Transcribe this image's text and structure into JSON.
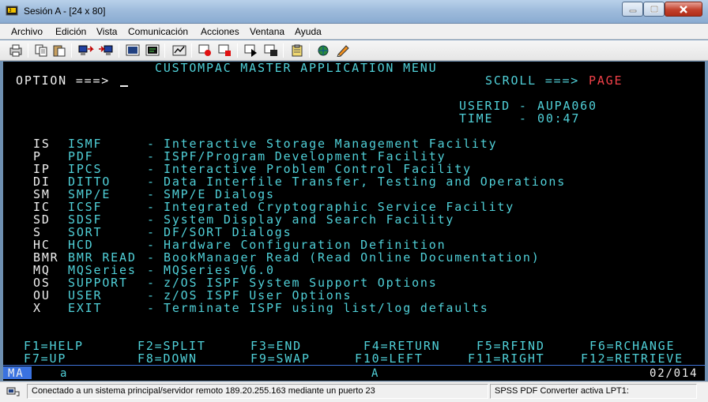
{
  "window": {
    "title": "Sesión A - [24 x 80]"
  },
  "menubar": {
    "items": [
      "Archivo",
      "Edición",
      "Vista",
      "Comunicación",
      "Acciones",
      "Ventana",
      "Ayuda"
    ]
  },
  "toolbar": {
    "icons": [
      "print-icon",
      "copy-icon",
      "paste-icon",
      "send-file-icon",
      "receive-file-icon",
      "screen-display-icon",
      "screen-color-icon",
      "macro-icon",
      "record-macro-icon",
      "stop-macro-icon",
      "play-macro-icon",
      "run-icon",
      "clipboard-icon",
      "network-icon",
      "keyboard-map-icon"
    ]
  },
  "terminal": {
    "header_title": "CUSTOMPAC MASTER APPLICATION MENU",
    "option_label": "OPTION ===>",
    "scroll_label": "SCROLL ===>",
    "scroll_value": "PAGE",
    "userid_label": "USERID -",
    "userid_value": "AUPA060",
    "time_label": "TIME   -",
    "time_value": "00:47",
    "menu_options": [
      {
        "code": "IS",
        "name": "ISMF",
        "dash": "-",
        "description": "Interactive Storage Management Facility"
      },
      {
        "code": "P",
        "name": "PDF",
        "dash": "-",
        "description": "ISPF/Program Development Facility"
      },
      {
        "code": "IP",
        "name": "IPCS",
        "dash": "-",
        "description": "Interactive Problem Control Facility"
      },
      {
        "code": "DI",
        "name": "DITTO",
        "dash": "-",
        "description": "Data Interfile Transfer, Testing and Operations"
      },
      {
        "code": "SM",
        "name": "SMP/E",
        "dash": "-",
        "description": "SMP/E Dialogs"
      },
      {
        "code": "IC",
        "name": "ICSF",
        "dash": "-",
        "description": "Integrated Cryptographic Service Facility"
      },
      {
        "code": "SD",
        "name": "SDSF",
        "dash": "-",
        "description": "System Display and Search Facility"
      },
      {
        "code": "S",
        "name": "SORT",
        "dash": "-",
        "description": "DF/SORT Dialogs"
      },
      {
        "code": "HC",
        "name": "HCD",
        "dash": "-",
        "description": "Hardware Configuration Definition"
      },
      {
        "code": "BMR",
        "name": "BMR READ",
        "dash": "-",
        "description": "BookManager Read (Read Online Documentation)"
      },
      {
        "code": "MQ",
        "name": "MQSeries",
        "dash": "-",
        "description": "MQSeries V6.0"
      },
      {
        "code": "OS",
        "name": "SUPPORT",
        "dash": "-",
        "description": "z/OS ISPF System Support Options"
      },
      {
        "code": "OU",
        "name": "USER",
        "dash": "-",
        "description": "z/OS ISPF User Options"
      },
      {
        "code": "X",
        "name": "EXIT",
        "dash": "-",
        "description": "Terminate ISPF using list/log defaults"
      }
    ],
    "pf_keys_row1": [
      "F1=HELP",
      "F2=SPLIT",
      "F3=END",
      "F4=RETURN",
      "F5=RFIND",
      "F6=RCHANGE"
    ],
    "pf_keys_row2": [
      "F7=UP",
      "F8=DOWN",
      "F9=SWAP",
      "F10=LEFT",
      "F11=RIGHT",
      "F12=RETRIEVE"
    ]
  },
  "oia": {
    "ma_label": "MA",
    "session_letter": "a",
    "mode_indicator": "A",
    "cursor_position": "02/014"
  },
  "statusbar": {
    "connection_text": "Conectado a un sistema principal/servidor remoto 189.20.255.163 mediante un puerto 23",
    "printer_text": "SPSS PDF Converter activa LPT1:"
  },
  "colors": {
    "terminal_bg": "#000000",
    "terminal_text": "#50d0d8",
    "highlight": "#f04048",
    "oia_accent": "#3a72e0"
  }
}
